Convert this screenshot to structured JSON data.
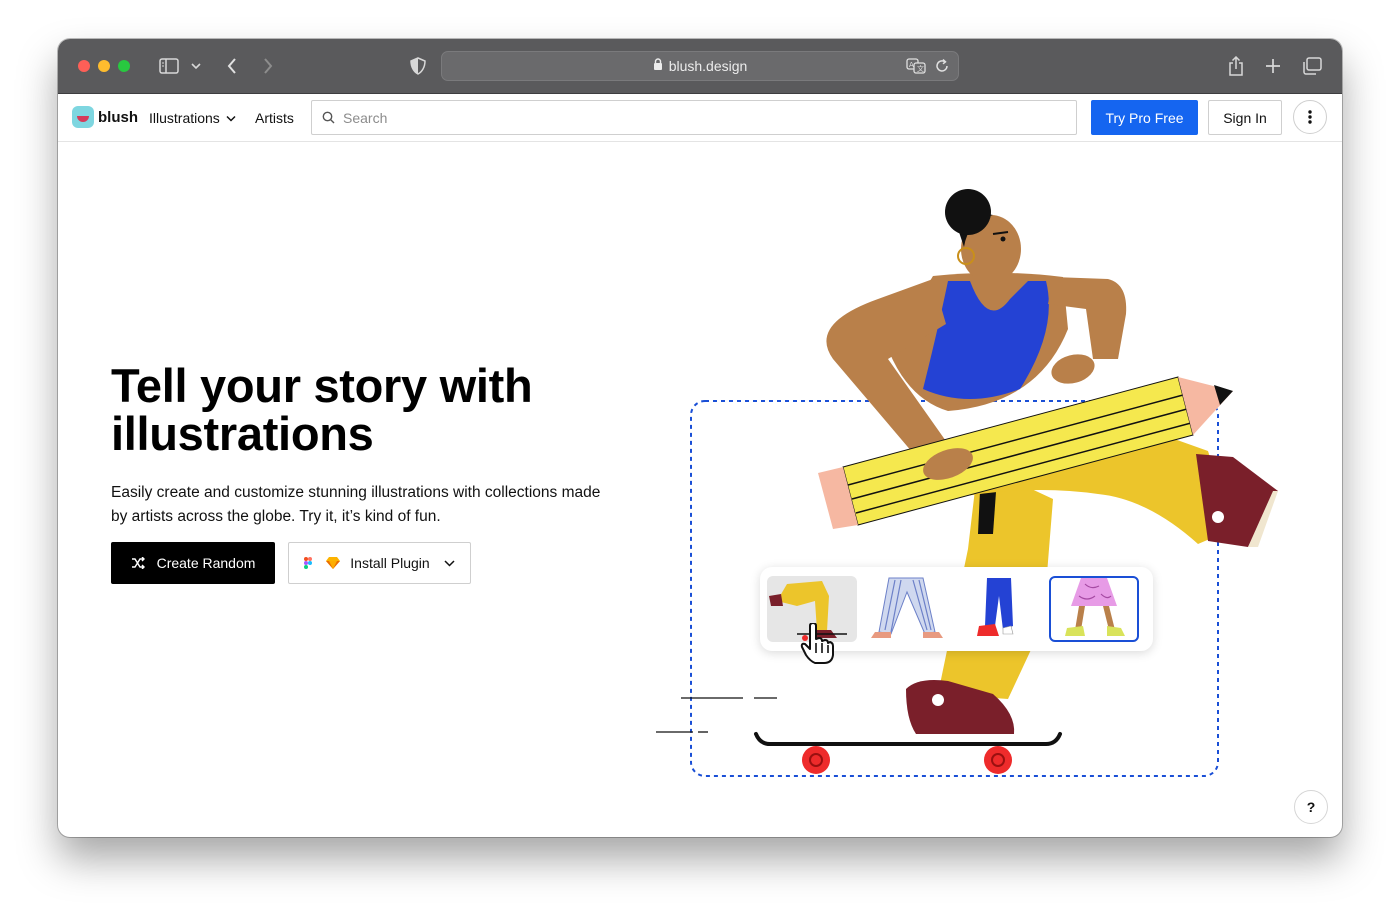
{
  "browser": {
    "url": "blush.design",
    "icons": [
      "sidebar-icon",
      "chevron-down-icon",
      "back-icon",
      "forward-icon",
      "shield-icon",
      "lock-icon",
      "translate-icon",
      "reload-icon",
      "share-icon",
      "plus-icon",
      "tabs-icon"
    ]
  },
  "nav": {
    "logo": "blush",
    "illustrations": "Illustrations",
    "artists": "Artists",
    "search_placeholder": "Search",
    "try_pro": "Try Pro Free",
    "sign_in": "Sign In"
  },
  "hero": {
    "title": "Tell your story with illustrations",
    "subtitle": "Easily create and customize stunning illustrations with collections made by artists across the globe. Try it, it’s kind of fun.",
    "create_random": "Create Random",
    "install_plugin": "Install Plugin"
  },
  "help": "?",
  "colors": {
    "accent": "#1565f0",
    "titlebar": "#5a5a5c",
    "pants": "#ecc52b",
    "top": "#2442d4",
    "skin": "#b9804a",
    "shoe": "#7a1f2a",
    "wheel": "#ee2b2b",
    "pencil": "#f5e84e"
  }
}
